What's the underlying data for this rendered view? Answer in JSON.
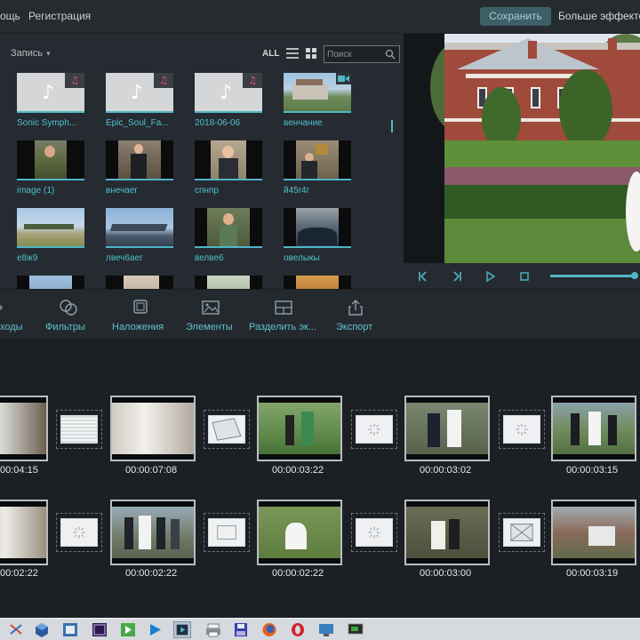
{
  "menu": {
    "help": "ощь",
    "register": "Регистрация",
    "save": "Сохранить",
    "more_effects": "Больше эффектов"
  },
  "media": {
    "filter": "Запись",
    "all": "ALL",
    "search_placeholder": "Поиск",
    "items": [
      {
        "label": "Sonic Symph...",
        "kind": "audio"
      },
      {
        "label": "Epic_Soul_Fa...",
        "kind": "audio"
      },
      {
        "label": "2018-06-06",
        "kind": "audio"
      },
      {
        "label": "венчание",
        "kind": "video"
      },
      {
        "label": "image (1)",
        "kind": "image"
      },
      {
        "label": "внечаег",
        "kind": "video"
      },
      {
        "label": "спнпр",
        "kind": "video"
      },
      {
        "label": "й45r4г",
        "kind": "video"
      },
      {
        "label": "е8ж9",
        "kind": "video"
      },
      {
        "label": "лвеч6аег",
        "kind": "video"
      },
      {
        "label": "велве6",
        "kind": "video"
      },
      {
        "label": "овелыкы",
        "kind": "video"
      }
    ]
  },
  "toolbar": {
    "transitions": "ходы",
    "filters": "Фильтры",
    "overlays": "Наложения",
    "elements": "Элементы",
    "split_screen": "Разделить эк...",
    "export": "Экспорт"
  },
  "storyboard": {
    "row1": [
      "00:04:15",
      "00:00:07:08",
      "00:00:03:22",
      "00:00:03:02",
      "00:00:03:15"
    ],
    "row2": [
      "00:02:22",
      "00:00:02:22",
      "00:00:02:22",
      "00:00:03:00",
      "00:00:03:19"
    ]
  },
  "taskbar": {
    "icons": [
      "virtualbox-icon",
      "photoshop-icon",
      "premiere-icon",
      "camtasia-icon",
      "terminal-icon",
      "media-icon",
      "printer-icon",
      "save-icon",
      "firefox-icon",
      "opera-icon",
      "screen-icon",
      "desktop-icon",
      "chat-icon"
    ]
  },
  "colors": {
    "accent": "#4fb6c8",
    "save_bg": "#3d5f66",
    "panel": "#262b31",
    "audio_badge": "#e55266"
  }
}
